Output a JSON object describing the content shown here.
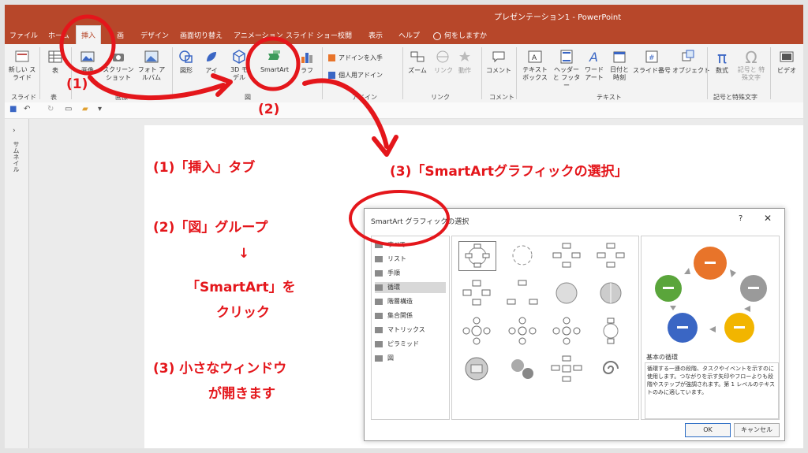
{
  "titlebar": {
    "title": "プレゼンテーション1  -  PowerPoint"
  },
  "tabs": [
    {
      "label": "ファイル"
    },
    {
      "label": "ホーム"
    },
    {
      "label": "挿入"
    },
    {
      "label": "画"
    },
    {
      "label": "デザイン"
    },
    {
      "label": "画面切り替え"
    },
    {
      "label": "アニメーション"
    },
    {
      "label": "スライド ショー"
    },
    {
      "label": "校閲"
    },
    {
      "label": "表示"
    },
    {
      "label": "ヘルプ"
    },
    {
      "label": "何をしますか"
    }
  ],
  "ribbon": {
    "new_slide": "新しい スライド",
    "table": "表",
    "images": "画像",
    "screenshot": "スクリーン ショット",
    "photo_album": "フォト アルバム",
    "shapes": "図形",
    "icons": "アイ",
    "3d_models": "3D モデル",
    "smartart": "SmartArt",
    "graph": "ラフ",
    "get_addins": "アドインを入手",
    "personal_addins": "個人用アドイン",
    "zoom": "ズーム",
    "link": "リンク",
    "action": "動作",
    "comment": "コメント",
    "textbox": "テキスト ボックス",
    "header_footer": "ヘッダーと フッター",
    "wordart": "ワード アート",
    "date_time": "日付と 時刻",
    "slide_number": "スライド番号",
    "object": "オブジェクト",
    "equation": "数式",
    "symbol": "記号と 特殊文字",
    "video": "ビデオ",
    "groups": {
      "slides": "スライド",
      "tables": "表",
      "images": "画像",
      "illustrations": "図",
      "addins": "アドイン",
      "links": "リンク",
      "comments": "コメント",
      "text": "テキスト",
      "symbols": "記号と特殊文字"
    }
  },
  "thumbpane": {
    "label": "サムネイル"
  },
  "annotations": {
    "num1": "(1)",
    "num2": "(2)",
    "step3_title": "(3)「SmartArtグラフィックの選択」",
    "step1": "(1)「挿入」タブ",
    "step2": "(2)「図」グループ",
    "arrow_down": "↓",
    "step2_click1": "「SmartArt」を",
    "step2_click2": "クリック",
    "step3_line1": "(3) 小さなウィンドウ",
    "step3_line2": "が開きます"
  },
  "dialog": {
    "title": "SmartArt グラフィックの選択",
    "help": "?",
    "close": "✕",
    "categories": [
      {
        "label": "すべて",
        "icon": "all-icon"
      },
      {
        "label": "リスト",
        "icon": "list-icon"
      },
      {
        "label": "手順",
        "icon": "process-icon"
      },
      {
        "label": "循環",
        "icon": "cycle-icon"
      },
      {
        "label": "階層構造",
        "icon": "hierarchy-icon"
      },
      {
        "label": "集合関係",
        "icon": "relationship-icon"
      },
      {
        "label": "マトリックス",
        "icon": "matrix-icon"
      },
      {
        "label": "ピラミッド",
        "icon": "pyramid-icon"
      },
      {
        "label": "図",
        "icon": "picture-icon"
      }
    ],
    "selected_category": "循環",
    "preview_name": "基本の循環",
    "preview_desc": "循環する一連の段階、タスクやイベントを示すのに使用します。つながりを示す矢印やフローよりも段階やステップが強調されます。第 1 レベルのテキストのみに適しています。",
    "ok": "OK",
    "cancel": "キャンセル"
  },
  "colors": {
    "title_bar": "#b7472a",
    "annotation": "#e4161b",
    "cycle_orange": "#e8742a",
    "cycle_gray": "#9a9a9a",
    "cycle_yellow": "#f2b500",
    "cycle_blue": "#3a66c4",
    "cycle_green": "#5aa53b"
  }
}
